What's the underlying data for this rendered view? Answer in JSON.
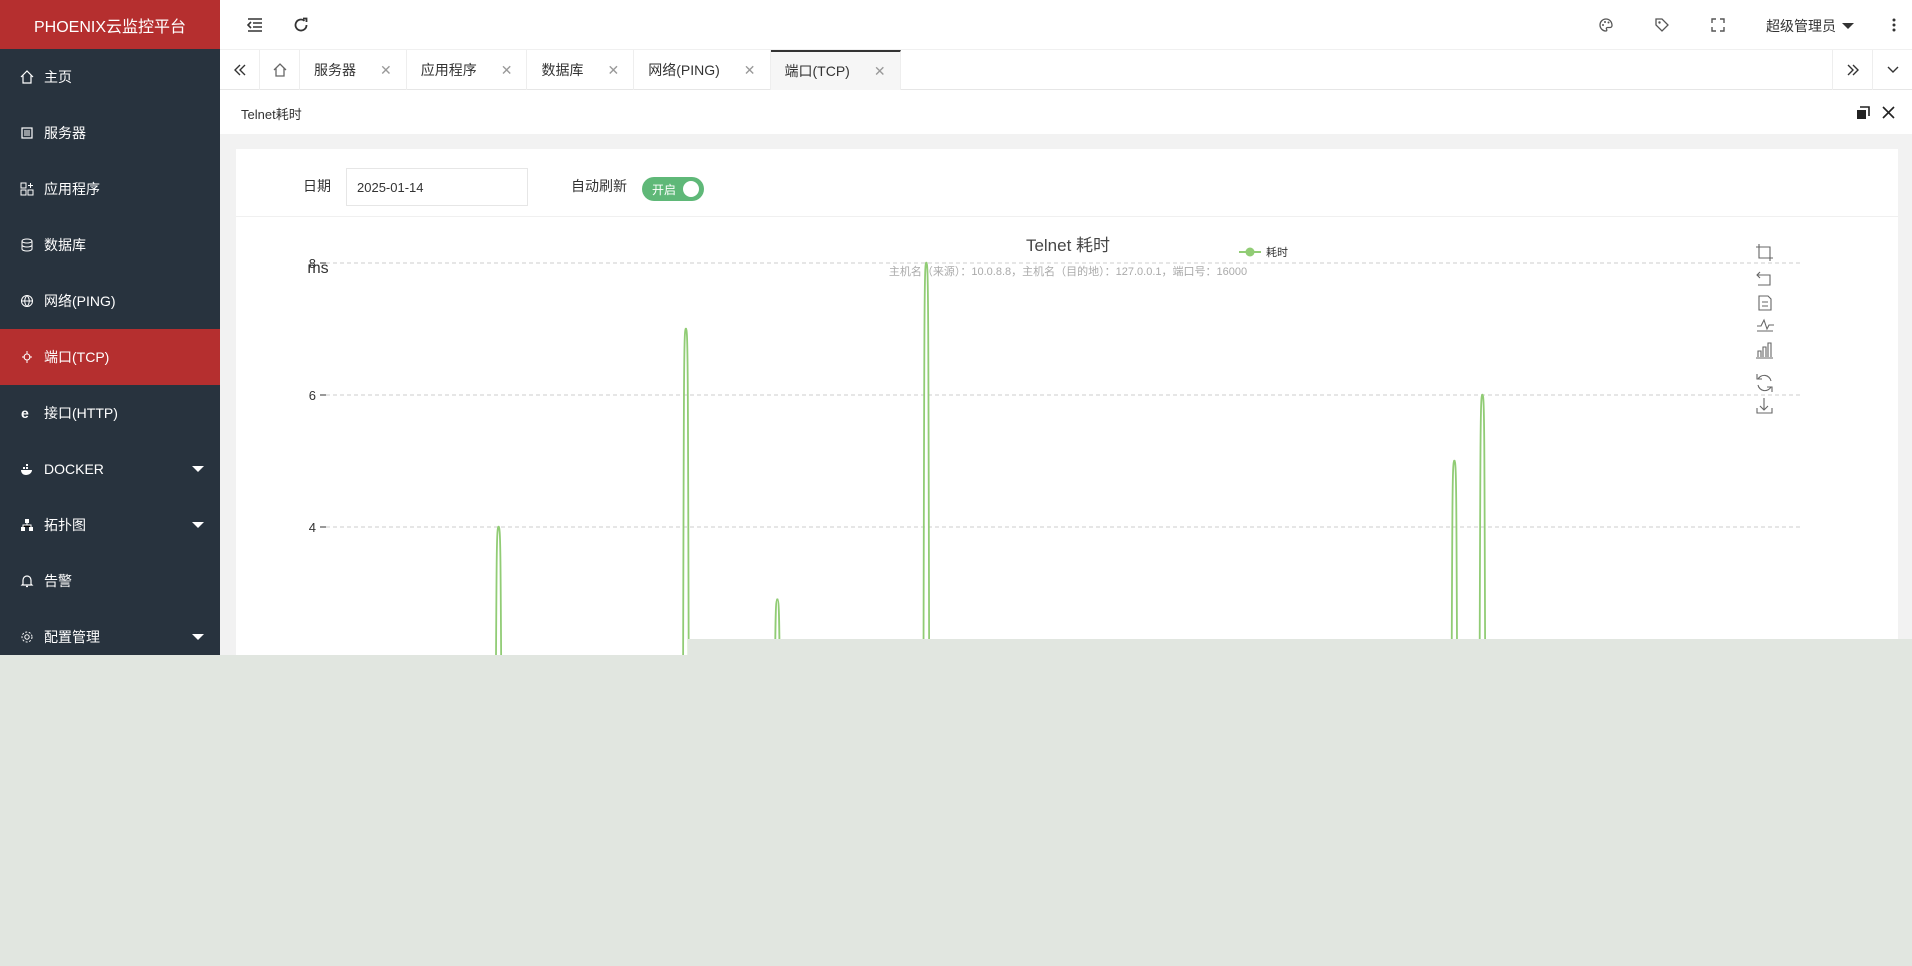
{
  "app": {
    "title": "PHOENIX云监控平台"
  },
  "sidebar": {
    "items": [
      {
        "label": "主页",
        "icon": "home-icon"
      },
      {
        "label": "服务器",
        "icon": "server-icon"
      },
      {
        "label": "应用程序",
        "icon": "app-icon"
      },
      {
        "label": "数据库",
        "icon": "database-icon"
      },
      {
        "label": "网络(PING)",
        "icon": "globe-icon"
      },
      {
        "label": "端口(TCP)",
        "icon": "port-icon",
        "active": true
      },
      {
        "label": "接口(HTTP)",
        "icon": "ie-icon"
      },
      {
        "label": "DOCKER",
        "icon": "docker-icon",
        "expandable": true
      },
      {
        "label": "拓扑图",
        "icon": "topology-icon",
        "expandable": true
      },
      {
        "label": "告警",
        "icon": "bell-icon"
      },
      {
        "label": "配置管理",
        "icon": "gear-icon",
        "expandable": true
      }
    ]
  },
  "topbar": {
    "user": "超级管理员"
  },
  "tabs": [
    {
      "label": "服务器"
    },
    {
      "label": "应用程序"
    },
    {
      "label": "数据库"
    },
    {
      "label": "网络(PING)"
    },
    {
      "label": "端口(TCP)",
      "active": true
    }
  ],
  "panel": {
    "title": "Telnet耗时"
  },
  "filters": {
    "date_label": "日期",
    "date_value": "2025-01-14",
    "refresh_label": "自动刷新",
    "switch_text": "开启"
  },
  "colors": {
    "brand": "#b52f2f",
    "sidebar": "#28333e",
    "series": "#91cc75",
    "switch": "#5fb878"
  },
  "chart_data": {
    "type": "line",
    "title": "Telnet 耗时",
    "subtitle": "主机名（来源）：10.0.8.8，主机名（目的地）：127.0.0.1，端口号：16000",
    "ylabel": "ms",
    "ylim": [
      0,
      8
    ],
    "yticks": [
      4,
      6,
      8
    ],
    "grid": true,
    "legend_position": "top",
    "series": [
      {
        "name": "耗时",
        "color": "#91cc75",
        "peaks": [
          {
            "t": 0.117,
            "v": 4
          },
          {
            "t": 0.244,
            "v": 7
          },
          {
            "t": 0.306,
            "v": 2.9
          },
          {
            "t": 0.407,
            "v": 8
          },
          {
            "t": 0.765,
            "v": 5
          },
          {
            "t": 0.784,
            "v": 6
          }
        ]
      }
    ]
  }
}
